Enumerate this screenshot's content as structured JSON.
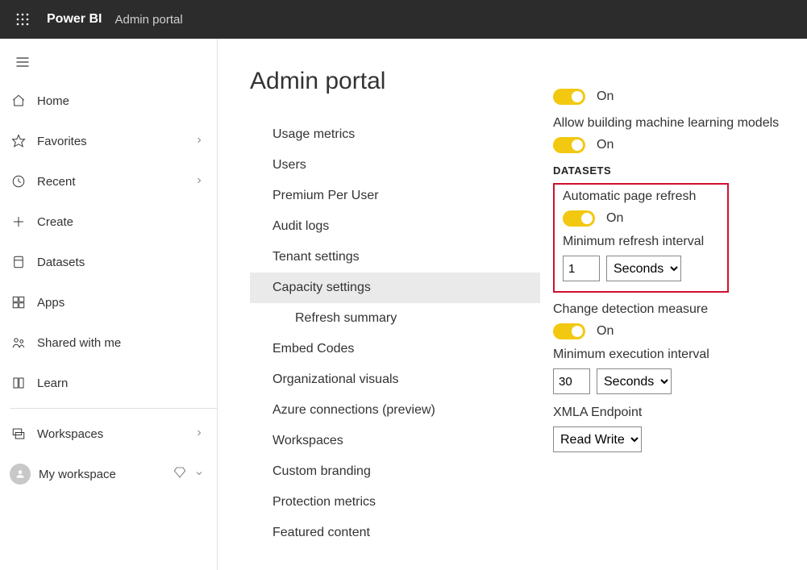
{
  "header": {
    "brand": "Power BI",
    "subtitle": "Admin portal"
  },
  "nav": {
    "items": [
      {
        "label": "Home",
        "icon": "home-icon",
        "expandable": false
      },
      {
        "label": "Favorites",
        "icon": "star-icon",
        "expandable": true
      },
      {
        "label": "Recent",
        "icon": "clock-icon",
        "expandable": true
      },
      {
        "label": "Create",
        "icon": "plus-icon",
        "expandable": false
      },
      {
        "label": "Datasets",
        "icon": "database-icon",
        "expandable": false
      },
      {
        "label": "Apps",
        "icon": "grid-icon",
        "expandable": false
      },
      {
        "label": "Shared with me",
        "icon": "shared-icon",
        "expandable": false
      },
      {
        "label": "Learn",
        "icon": "book-icon",
        "expandable": false
      }
    ],
    "workspaces_label": "Workspaces",
    "my_workspace_label": "My workspace"
  },
  "admin": {
    "title": "Admin portal",
    "items": [
      "Usage metrics",
      "Users",
      "Premium Per User",
      "Audit logs",
      "Tenant settings",
      "Capacity settings",
      "Refresh summary",
      "Embed Codes",
      "Organizational visuals",
      "Azure connections (preview)",
      "Workspaces",
      "Custom branding",
      "Protection metrics",
      "Featured content"
    ],
    "selected_index": 5,
    "sub_index": 6
  },
  "settings": {
    "on_label": "On",
    "ml_label": "Allow building machine learning models",
    "datasets_heading": "DATASETS",
    "apr_label": "Automatic page refresh",
    "min_refresh_label": "Minimum refresh interval",
    "min_refresh_value": "1",
    "min_refresh_unit": "Seconds",
    "cdm_label": "Change detection measure",
    "min_exec_label": "Minimum execution interval",
    "min_exec_value": "30",
    "min_exec_unit": "Seconds",
    "xmla_label": "XMLA Endpoint",
    "xmla_value": "Read Write"
  }
}
